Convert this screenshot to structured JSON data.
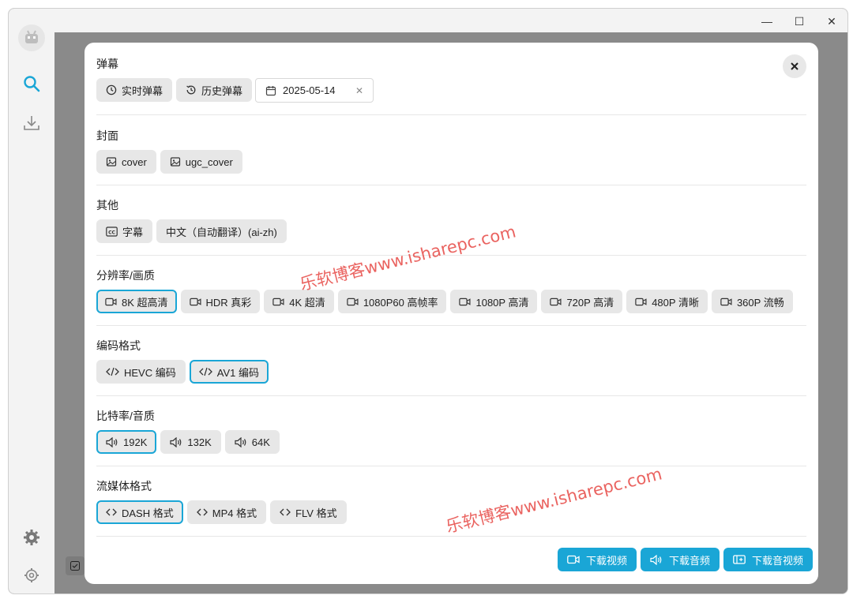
{
  "window": {
    "controls": [
      "—",
      "☐",
      "✕"
    ]
  },
  "sidebar": {
    "items": [
      {
        "name": "search",
        "icon": "search-icon"
      },
      {
        "name": "download",
        "icon": "download-icon"
      },
      {
        "name": "plugin",
        "icon": "gear-icon"
      },
      {
        "name": "settings",
        "icon": "settings-icon"
      }
    ]
  },
  "modal": {
    "close_label": "×",
    "danmaku": {
      "title": "弹幕",
      "realtime": "实时弹幕",
      "history": "历史弹幕",
      "date": "2025-05-14",
      "clear": "✕"
    },
    "cover": {
      "title": "封面",
      "items": [
        "cover",
        "ugc_cover"
      ]
    },
    "other": {
      "title": "其他",
      "subtitle": "字幕",
      "lang": "中文（自动翻译）(ai-zh)"
    },
    "resolution": {
      "title": "分辨率/画质",
      "items": [
        "8K 超高清",
        "HDR 真彩",
        "4K 超清",
        "1080P60 高帧率",
        "1080P 高清",
        "720P 高清",
        "480P 清晰",
        "360P 流畅"
      ],
      "selected": 0
    },
    "codec": {
      "title": "编码格式",
      "items": [
        "HEVC 编码",
        "AV1 编码"
      ],
      "selected": 1
    },
    "bitrate": {
      "title": "比特率/音质",
      "items": [
        "192K",
        "132K",
        "64K"
      ],
      "selected": 0
    },
    "stream": {
      "title": "流媒体格式",
      "items": [
        "DASH 格式",
        "MP4 格式",
        "FLV 格式"
      ],
      "selected": 0
    },
    "actions": {
      "video": "下载视频",
      "audio": "下载音频",
      "both": "下载音视频"
    }
  },
  "watermarks": [
    "乐软博客www.isharepc.com",
    "乐软博客www.isharepc.com"
  ],
  "colors": {
    "accent": "#1aa6d6",
    "chip_bg": "#e7e7e7",
    "watermark": "#e8534f"
  }
}
